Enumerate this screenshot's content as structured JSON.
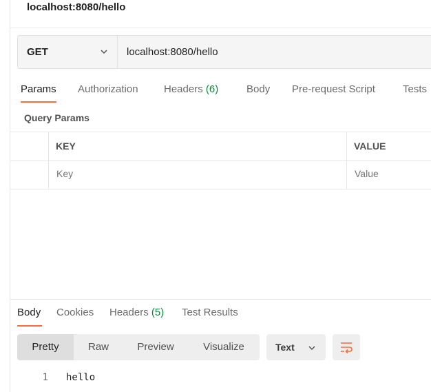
{
  "request": {
    "title": "localhost:8080/hello",
    "method": "GET",
    "url": "localhost:8080/hello",
    "tabs": [
      {
        "label": "Params",
        "count": ""
      },
      {
        "label": "Authorization",
        "count": ""
      },
      {
        "label": "Headers",
        "count": "(6)"
      },
      {
        "label": "Body",
        "count": ""
      },
      {
        "label": "Pre-request Script",
        "count": ""
      },
      {
        "label": "Tests",
        "count": ""
      }
    ],
    "active_tab": "Params"
  },
  "query_params": {
    "label": "Query Params",
    "columns": [
      "KEY",
      "VALUE"
    ],
    "key_placeholder": "Key",
    "value_placeholder": "Value"
  },
  "response": {
    "tabs": [
      {
        "label": "Body",
        "count": ""
      },
      {
        "label": "Cookies",
        "count": ""
      },
      {
        "label": "Headers",
        "count": "(5)"
      },
      {
        "label": "Test Results",
        "count": ""
      }
    ],
    "active_tab": "Body",
    "view_modes": [
      "Pretty",
      "Raw",
      "Preview",
      "Visualize"
    ],
    "active_view": "Pretty",
    "format": "Text",
    "lines": [
      {
        "number": "1",
        "text": "hello"
      }
    ]
  },
  "colors": {
    "accent": "#ff6c37",
    "count": "#0a8a3d"
  },
  "icons": {
    "method_dropdown": "chevron-down-icon",
    "format_dropdown": "chevron-down-icon",
    "wrap": "wrap-lines-icon"
  }
}
